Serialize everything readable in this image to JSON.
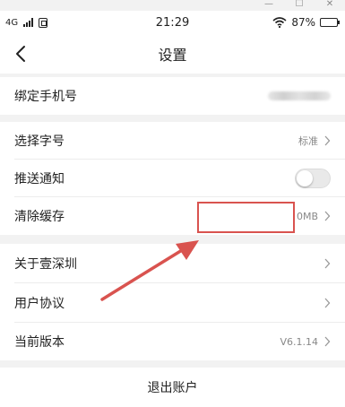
{
  "window_controls": {
    "minimize": "—",
    "maximize": "☐",
    "close": "✕"
  },
  "statusbar": {
    "network": "4G",
    "time": "21:29",
    "battery": "87%",
    "battery_level": 0.87
  },
  "navbar": {
    "title": "设置"
  },
  "rows": {
    "phone": {
      "label": "绑定手机号"
    },
    "font": {
      "label": "选择字号",
      "value": "标准"
    },
    "push": {
      "label": "推送通知",
      "enabled": false
    },
    "cache": {
      "label": "清除缓存",
      "value": "0MB"
    },
    "about": {
      "label": "关于壹深圳"
    },
    "agreement": {
      "label": "用户协议"
    },
    "version": {
      "label": "当前版本",
      "value": "V6.1.14"
    }
  },
  "logout": {
    "label": "退出账户"
  },
  "colors": {
    "annotation": "#d9534f",
    "background": "#f2f2f2"
  }
}
